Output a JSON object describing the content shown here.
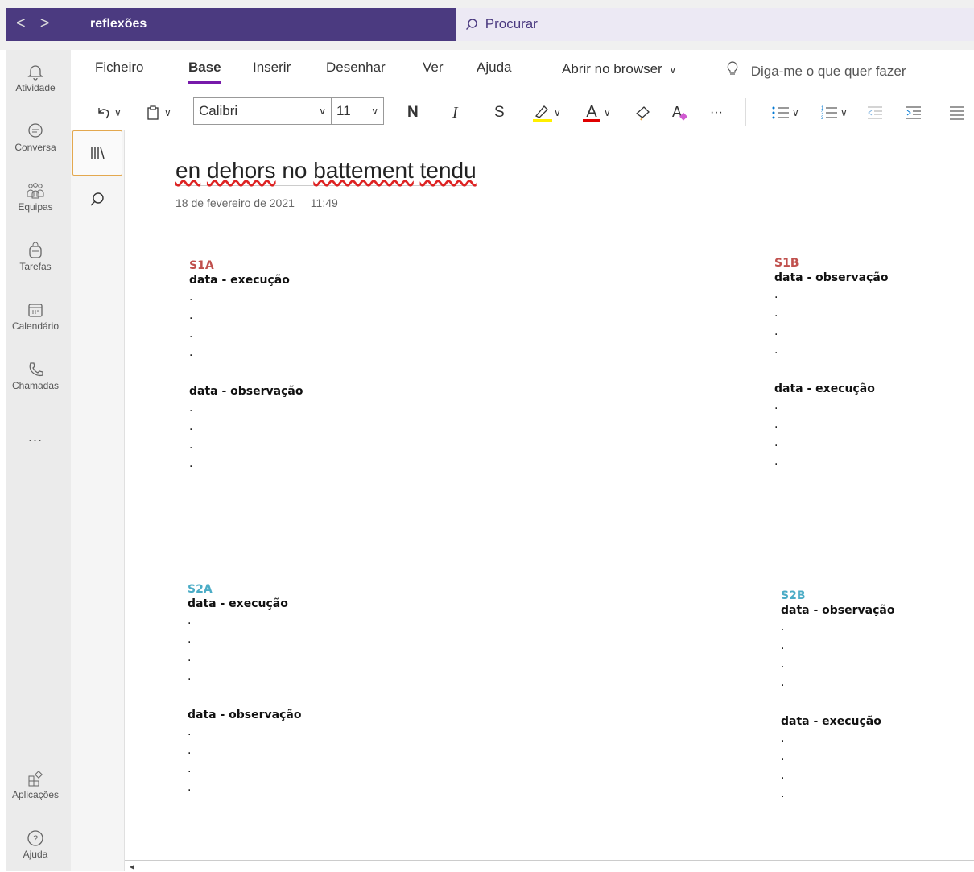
{
  "topbar": {
    "back": "<",
    "forward": ">",
    "notebook_title": "reflexões",
    "search_placeholder": "Procurar"
  },
  "rail": [
    {
      "label": "Atividade",
      "icon": "bell-icon"
    },
    {
      "label": "Conversa",
      "icon": "chat-icon"
    },
    {
      "label": "Equipas",
      "icon": "teams-icon"
    },
    {
      "label": "Tarefas",
      "icon": "backpack-icon"
    },
    {
      "label": "Calendário",
      "icon": "calendar-icon"
    },
    {
      "label": "Chamadas",
      "icon": "phone-icon"
    },
    {
      "label": "...",
      "icon": "more-icon"
    },
    {
      "label": "Aplicações",
      "icon": "apps-icon"
    },
    {
      "label": "Ajuda",
      "icon": "help-icon"
    }
  ],
  "ribbon": {
    "tabs": [
      "Ficheiro",
      "Base",
      "Inserir",
      "Desenhar",
      "Ver",
      "Ajuda"
    ],
    "active_tab": "Base",
    "open_browser": "Abrir no browser",
    "tell_me": "Diga-me o que quer fazer",
    "font_name": "Calibri",
    "font_size": "11",
    "bold": "N",
    "italic": "I",
    "underline": "S",
    "more": "···"
  },
  "page": {
    "title_words": [
      "en",
      "dehors",
      "no",
      "battement",
      "tendu"
    ],
    "date": "18 de fevereiro de 2021",
    "time": "11:49"
  },
  "blocks": [
    {
      "section": "S1A",
      "color": "#c0504d",
      "first": "data - execução",
      "second": "data - observação"
    },
    {
      "section": "S1B",
      "color": "#c0504d",
      "first": "data - observação",
      "second": "data - execução"
    },
    {
      "section": "S2A",
      "color": "#4bacc6",
      "first": "data  - execução",
      "second": "data - observação"
    },
    {
      "section": "S2B",
      "color": "#4bacc6",
      "first": "data - observação",
      "second": "data - execução"
    }
  ],
  "dot": "."
}
